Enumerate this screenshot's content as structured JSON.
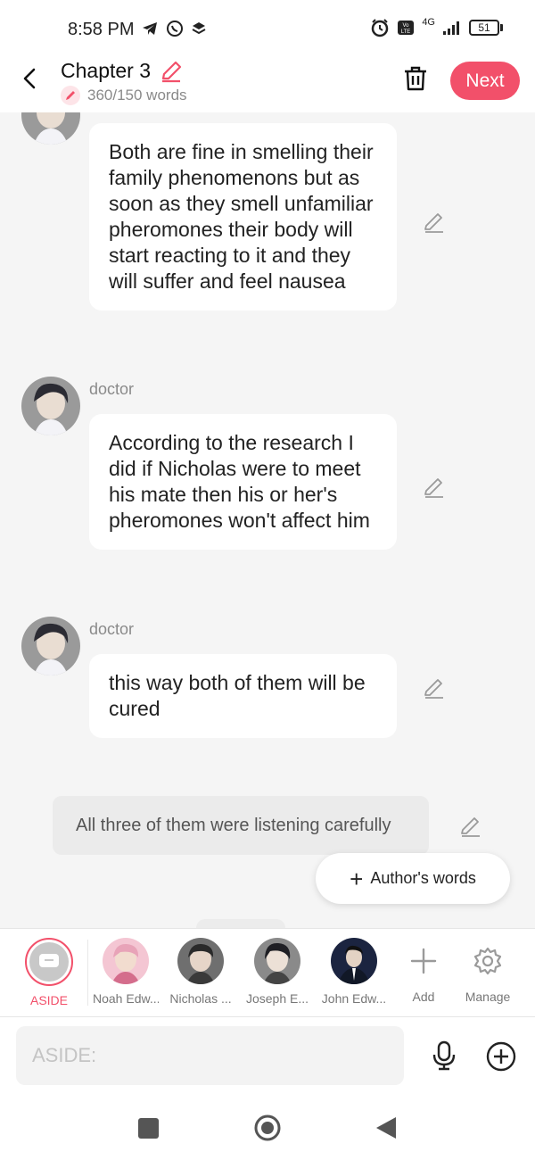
{
  "status_bar": {
    "time": "8:58 PM",
    "network": "4G",
    "battery": "51",
    "icons": [
      "telegram-icon",
      "whatsapp-icon",
      "stack-icon",
      "alarm-icon",
      "volte-icon",
      "signal-icon",
      "battery-icon"
    ]
  },
  "header": {
    "chapter_title": "Chapter 3",
    "word_count": "360/150 words",
    "next_label": "Next",
    "accent_color": "#f2506a"
  },
  "messages": [
    {
      "speaker": "",
      "text": "Both are fine in smelling their family phenomenons but as soon as they smell unfamiliar pheromones their body will start reacting to it and they will suffer and feel nausea"
    },
    {
      "speaker": "doctor",
      "text": "According to the research I did if Nicholas were to meet his mate then his or her's pheromones won't affect him"
    },
    {
      "speaker": "doctor",
      "text": "this way both of them will be cured"
    }
  ],
  "aside_message": {
    "text": "All three of them were listening carefully"
  },
  "authors_words_button": {
    "label": "Author's words"
  },
  "characters": [
    {
      "label": "ASIDE",
      "selected": true
    },
    {
      "label": "Noah Edw..."
    },
    {
      "label": "Nicholas ..."
    },
    {
      "label": "Joseph E..."
    },
    {
      "label": "John Edw..."
    }
  ],
  "tools": {
    "add_label": "Add",
    "manage_label": "Manage"
  },
  "input": {
    "placeholder": "ASIDE:"
  }
}
